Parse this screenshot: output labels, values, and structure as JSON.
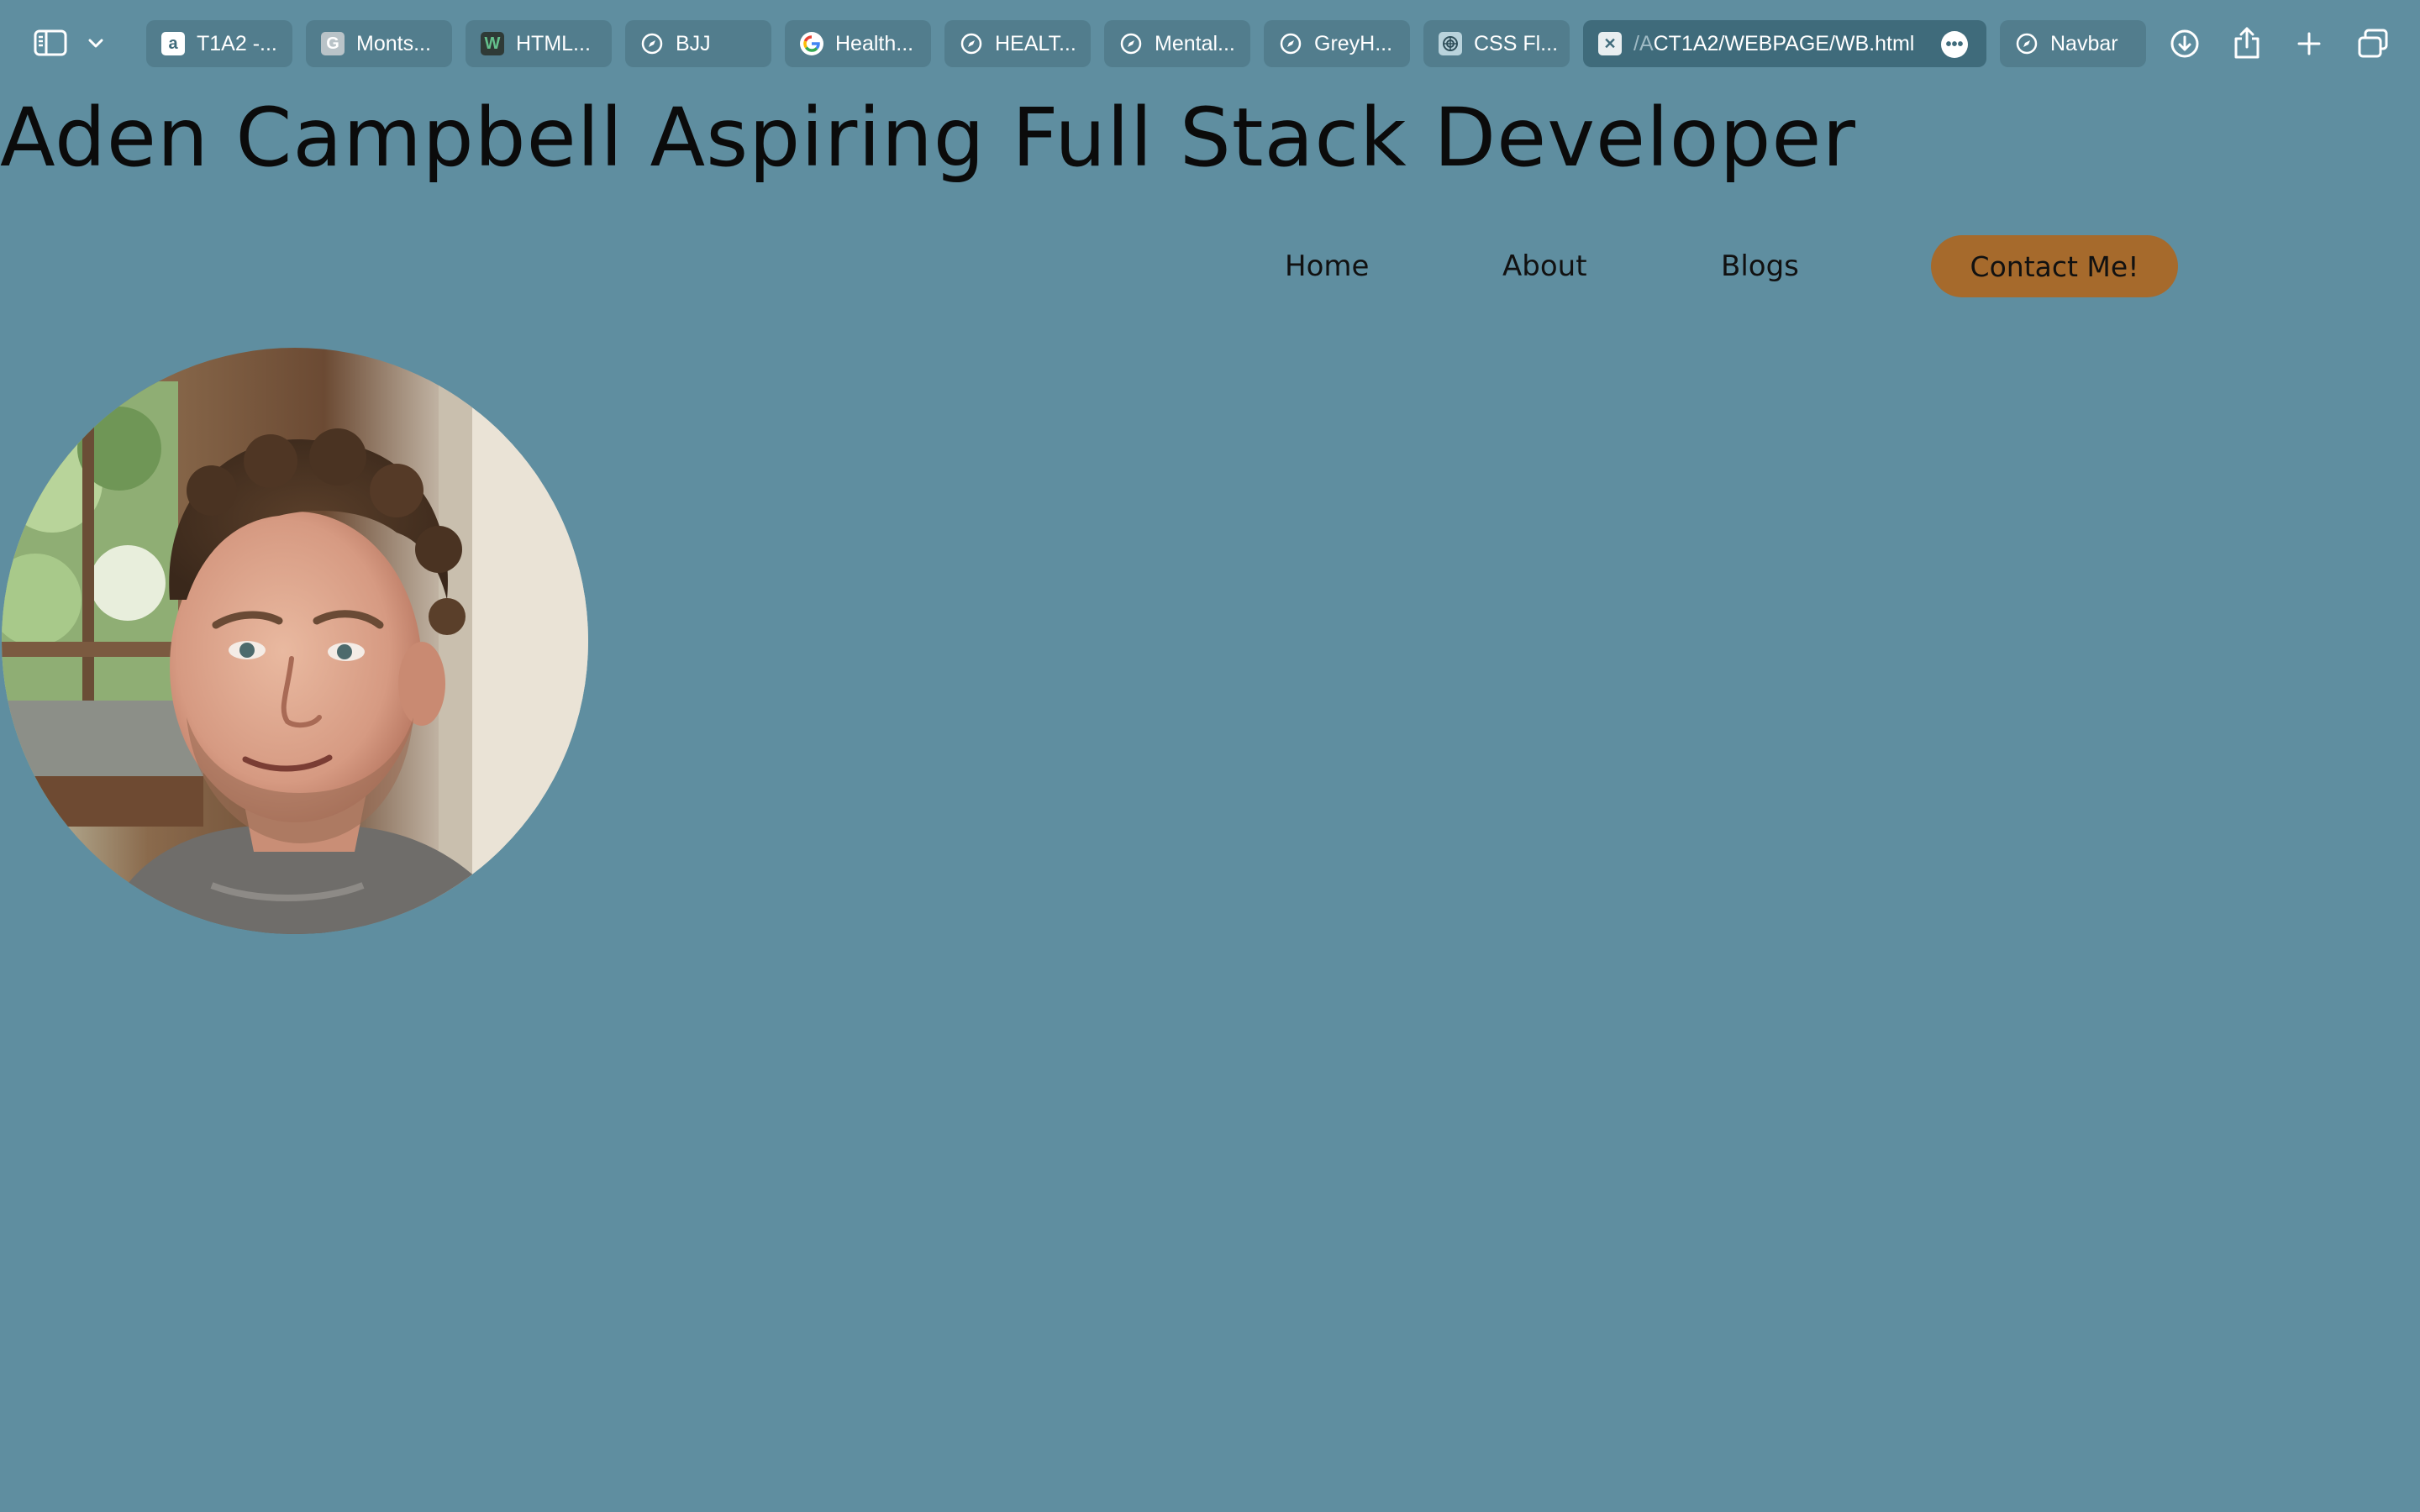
{
  "browser": {
    "tabs": [
      {
        "label": "T1A2 -...",
        "icon": "app-favicon-icon"
      },
      {
        "label": "Monts...",
        "icon": "g-letter-favicon-icon"
      },
      {
        "label": "HTML...",
        "icon": "w-favicon-icon"
      },
      {
        "label": "BJJ",
        "icon": "compass-icon"
      },
      {
        "label": "Health...",
        "icon": "google-favicon-icon"
      },
      {
        "label": "HEALT...",
        "icon": "compass-icon"
      },
      {
        "label": "Mental...",
        "icon": "compass-icon"
      },
      {
        "label": "GreyH...",
        "icon": "compass-icon"
      },
      {
        "label": "CSS Fl...",
        "icon": "chatgpt-favicon-icon"
      }
    ],
    "active_tab": {
      "prefix": "/A",
      "label": "CT1A2/WEBPAGE/WB.html",
      "icon": "close-icon",
      "menu_glyph": "•••"
    },
    "last_tab": {
      "label": "Navbar",
      "icon": "compass-icon"
    },
    "toolbar_icons": [
      "sidebar-icon",
      "chevron-down-icon",
      "download-icon",
      "share-icon",
      "plus-icon",
      "tab-overview-icon"
    ]
  },
  "page": {
    "title": "Aden Campbell Aspiring Full Stack Developer",
    "nav": {
      "home": "Home",
      "about": "About",
      "blogs": "Blogs",
      "contact": "Contact Me!"
    }
  },
  "colors": {
    "background": "#5f8ea0",
    "tab_background": "#527d8d",
    "active_tab_background": "#3f6b7b",
    "contact_button": "#a66a2c",
    "text": "#111111"
  }
}
